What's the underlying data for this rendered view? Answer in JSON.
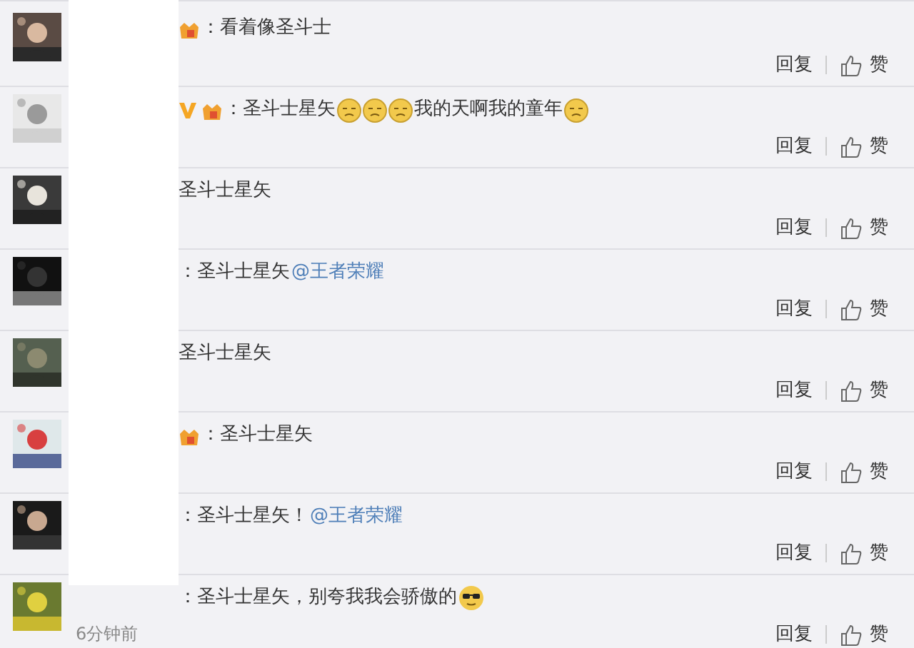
{
  "comments": [
    {
      "segments": [
        {
          "kind": "badge"
        },
        {
          "kind": "text",
          "text": "：看着像圣斗士"
        }
      ],
      "reply": "回复",
      "like": "赞"
    },
    {
      "segments": [
        {
          "kind": "vip"
        },
        {
          "kind": "badge"
        },
        {
          "kind": "text",
          "text": "：圣斗士星矢"
        },
        {
          "kind": "emoji"
        },
        {
          "kind": "emoji"
        },
        {
          "kind": "emoji"
        },
        {
          "kind": "text",
          "text": "我的天啊我的童年"
        },
        {
          "kind": "emoji"
        }
      ],
      "reply": "回复",
      "like": "赞"
    },
    {
      "segments": [
        {
          "kind": "text",
          "text": "圣斗士星矢"
        }
      ],
      "reply": "回复",
      "like": "赞"
    },
    {
      "segments": [
        {
          "kind": "text",
          "text": "：圣斗士星矢"
        },
        {
          "kind": "mention",
          "text": "@王者荣耀"
        }
      ],
      "reply": "回复",
      "like": "赞"
    },
    {
      "segments": [
        {
          "kind": "text",
          "text": "圣斗士星矢"
        }
      ],
      "reply": "回复",
      "like": "赞"
    },
    {
      "segments": [
        {
          "kind": "badge"
        },
        {
          "kind": "text",
          "text": "：圣斗士星矢"
        }
      ],
      "reply": "回复",
      "like": "赞"
    },
    {
      "segments": [
        {
          "kind": "text",
          "text": "：圣斗士星矢！"
        },
        {
          "kind": "mention",
          "text": "@王者荣耀"
        }
      ],
      "reply": "回复",
      "like": "赞"
    },
    {
      "segments": [
        {
          "kind": "text",
          "text": "：圣斗士星矢，别夸我我会骄傲的"
        },
        {
          "kind": "sunglasses"
        }
      ],
      "time": "6分钟前",
      "reply": "回复",
      "like": "赞"
    }
  ]
}
